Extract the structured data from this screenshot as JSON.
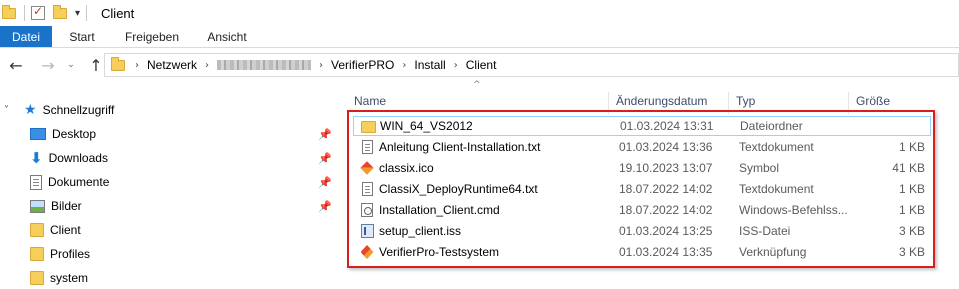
{
  "window": {
    "title": "Client",
    "quick_access_arrow": "▾"
  },
  "ribbon": {
    "tabs": [
      "Datei",
      "Start",
      "Freigeben",
      "Ansicht"
    ]
  },
  "navigation": {
    "back_glyph": "←",
    "forward_glyph": "→",
    "recent_glyph": "⌄",
    "up_glyph": "↑",
    "breadcrumb": [
      "Netzwerk",
      "VerifierPRO",
      "Install",
      "Client"
    ],
    "separator": "›"
  },
  "navpane": {
    "quick_access": {
      "label": "Schnellzugriff",
      "icon": "star-icon"
    },
    "items": [
      {
        "label": "Desktop",
        "icon": "desktop-icon",
        "pinned": true
      },
      {
        "label": "Downloads",
        "icon": "download-icon",
        "pinned": true
      },
      {
        "label": "Dokumente",
        "icon": "documents-icon",
        "pinned": true
      },
      {
        "label": "Bilder",
        "icon": "pictures-icon",
        "pinned": true
      },
      {
        "label": "Client",
        "icon": "folder-icon",
        "pinned": false
      },
      {
        "label": "Profiles",
        "icon": "folder-icon",
        "pinned": false
      },
      {
        "label": "system",
        "icon": "folder-icon",
        "pinned": false
      }
    ],
    "pin_glyph": "📌"
  },
  "filelist": {
    "columns": {
      "name": "Name",
      "date": "Änderungsdatum",
      "type": "Typ",
      "size": "Größe"
    },
    "sort_indicator": "^",
    "files": [
      {
        "name": "WIN_64_VS2012",
        "date": "01.03.2024 13:31",
        "type": "Dateiordner",
        "size": "",
        "icon": "folder-icon"
      },
      {
        "name": "Anleitung Client-Installation.txt",
        "date": "01.03.2024 13:36",
        "type": "Textdokument",
        "size": "1 KB",
        "icon": "text-file-icon"
      },
      {
        "name": "classix.ico",
        "date": "19.10.2023 13:07",
        "type": "Symbol",
        "size": "41 KB",
        "icon": "ico-file-icon"
      },
      {
        "name": "ClassiX_DeployRuntime64.txt",
        "date": "18.07.2022 14:02",
        "type": "Textdokument",
        "size": "1 KB",
        "icon": "text-file-icon"
      },
      {
        "name": "Installation_Client.cmd",
        "date": "18.07.2022 14:02",
        "type": "Windows-Befehlss...",
        "size": "1 KB",
        "icon": "cmd-file-icon"
      },
      {
        "name": "setup_client.iss",
        "date": "01.03.2024 13:25",
        "type": "ISS-Datei",
        "size": "3 KB",
        "icon": "iss-file-icon"
      },
      {
        "name": "VerifierPro-Testsystem",
        "date": "01.03.2024 13:35",
        "type": "Verknüpfung",
        "size": "3 KB",
        "icon": "shortcut-icon"
      }
    ]
  },
  "colors": {
    "file_tab": "#1a73c8",
    "highlight_frame": "#d81e1e",
    "selection_border": "#99d1ff",
    "column_header_text": "#3c4d6b"
  }
}
